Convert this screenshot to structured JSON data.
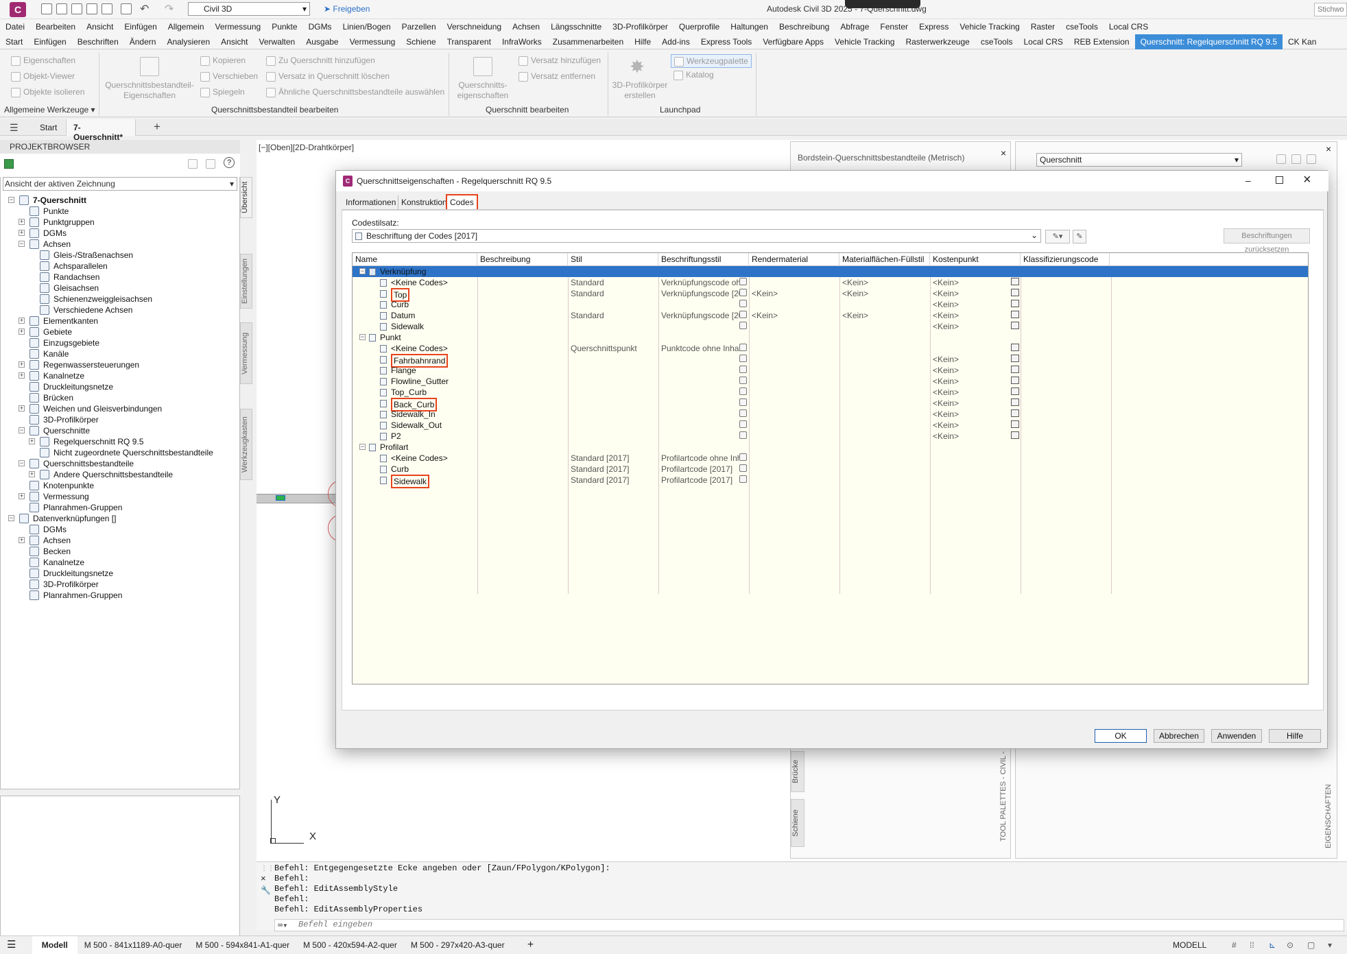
{
  "titlebar": {
    "logo": "C",
    "workspace": "Civil 3D",
    "share": "Freigeben",
    "title": "Autodesk Civil 3D 2025 - 7-Querschnitt.dwg",
    "search": "Stichwo"
  },
  "menu1": [
    "Datei",
    "Bearbeiten",
    "Ansicht",
    "Einfügen",
    "Allgemein",
    "Vermessung",
    "Punkte",
    "DGMs",
    "Linien/Bogen",
    "Parzellen",
    "Verschneidung",
    "Achsen",
    "Längsschnitte",
    "3D-Profilkörper",
    "Querprofile",
    "Haltungen",
    "Beschreibung",
    "Abfrage",
    "Fenster",
    "Express",
    "Vehicle Tracking",
    "Raster",
    "cseTools",
    "Local CRS"
  ],
  "menu2": [
    "Start",
    "Einfügen",
    "Beschriften",
    "Ändern",
    "Analysieren",
    "Ansicht",
    "Verwalten",
    "Ausgabe",
    "Vermessung",
    "Schiene",
    "Transparent",
    "InfraWorks",
    "Zusammenarbeiten",
    "Hilfe",
    "Add-ins",
    "Express Tools",
    "Verfügbare Apps",
    "Vehicle Tracking",
    "Rasterwerkzeuge",
    "cseTools",
    "Local CRS",
    "REB Extension",
    "Querschnitt: Regelquerschnitt RQ 9.5",
    "CK Kan"
  ],
  "ribbon": {
    "general": {
      "items": [
        "Eigenschaften",
        "Objekt-Viewer",
        "Objekte isolieren"
      ],
      "title": "Allgemeine Werkzeuge"
    },
    "part": {
      "big": "Querschnittsbestandteil-Eigenschaften",
      "col1": [
        "Kopieren",
        "Verschieben",
        "Spiegeln"
      ],
      "col2": [
        "Zu Querschnitt hinzufügen",
        "Versatz in Querschnitt löschen",
        "Ähnliche Querschnittsbestandteile auswählen"
      ],
      "title": "Querschnittsbestandteil bearbeiten"
    },
    "assembly": {
      "big": "Querschnitts-eigenschaften",
      "col": [
        "Versatz hinzufügen",
        "Versatz entfernen"
      ],
      "title": "Querschnitt bearbeiten"
    },
    "launch": {
      "big": "3D-Profilkörper erstellen",
      "col": [
        "Werkzeugpalette",
        "Katalog"
      ],
      "title": "Launchpad"
    }
  },
  "doctabs": {
    "start": "Start",
    "current": "7-Querschnitt*"
  },
  "browser": {
    "title": "PROJEKTBROWSER",
    "view": "Ansicht der aktiven Zeichnung",
    "tree": [
      {
        "label": "7-Querschnitt",
        "lvl": 0,
        "bold": true,
        "t": "-"
      },
      {
        "label": "Punkte",
        "lvl": 1,
        "t": ""
      },
      {
        "label": "Punktgruppen",
        "lvl": 1,
        "t": "+"
      },
      {
        "label": "DGMs",
        "lvl": 1,
        "t": "+"
      },
      {
        "label": "Achsen",
        "lvl": 1,
        "t": "-"
      },
      {
        "label": "Gleis-/Straßenachsen",
        "lvl": 2,
        "t": ""
      },
      {
        "label": "Achsparallelen",
        "lvl": 2,
        "t": ""
      },
      {
        "label": "Randachsen",
        "lvl": 2,
        "t": ""
      },
      {
        "label": "Gleisachsen",
        "lvl": 2,
        "t": ""
      },
      {
        "label": "Schienenzweiggleisachsen",
        "lvl": 2,
        "t": ""
      },
      {
        "label": "Verschiedene Achsen",
        "lvl": 2,
        "t": ""
      },
      {
        "label": "Elementkanten",
        "lvl": 1,
        "t": "+"
      },
      {
        "label": "Gebiete",
        "lvl": 1,
        "t": "+"
      },
      {
        "label": "Einzugsgebiete",
        "lvl": 1,
        "t": ""
      },
      {
        "label": "Kanäle",
        "lvl": 1,
        "t": ""
      },
      {
        "label": "Regenwassersteuerungen",
        "lvl": 1,
        "t": "+"
      },
      {
        "label": "Kanalnetze",
        "lvl": 1,
        "t": "+"
      },
      {
        "label": "Druckleitungsnetze",
        "lvl": 1,
        "t": ""
      },
      {
        "label": "Brücken",
        "lvl": 1,
        "t": ""
      },
      {
        "label": "Weichen und Gleisverbindungen",
        "lvl": 1,
        "t": "+"
      },
      {
        "label": "3D-Profilkörper",
        "lvl": 1,
        "t": ""
      },
      {
        "label": "Querschnitte",
        "lvl": 1,
        "t": "-"
      },
      {
        "label": "Regelquerschnitt RQ 9.5",
        "lvl": 2,
        "t": "+"
      },
      {
        "label": "Nicht zugeordnete Querschnittsbestandteile",
        "lvl": 2,
        "t": ""
      },
      {
        "label": "Querschnittsbestandteile",
        "lvl": 1,
        "t": "-"
      },
      {
        "label": "Andere Querschnittsbestandteile",
        "lvl": 2,
        "t": "+"
      },
      {
        "label": "Knotenpunkte",
        "lvl": 1,
        "t": ""
      },
      {
        "label": "Vermessung",
        "lvl": 1,
        "t": "+"
      },
      {
        "label": "Planrahmen-Gruppen",
        "lvl": 1,
        "t": ""
      },
      {
        "label": "Datenverknüpfungen []",
        "lvl": 0,
        "t": "-"
      },
      {
        "label": "DGMs",
        "lvl": 1,
        "t": ""
      },
      {
        "label": "Achsen",
        "lvl": 1,
        "t": "+"
      },
      {
        "label": "Becken",
        "lvl": 1,
        "t": ""
      },
      {
        "label": "Kanalnetze",
        "lvl": 1,
        "t": ""
      },
      {
        "label": "Druckleitungsnetze",
        "lvl": 1,
        "t": ""
      },
      {
        "label": "3D-Profilkörper",
        "lvl": 1,
        "t": ""
      },
      {
        "label": "Planrahmen-Gruppen",
        "lvl": 1,
        "t": ""
      }
    ],
    "sidetabs": [
      "Übersicht",
      "Einstellungen",
      "Vermessung",
      "Werkzeugkasten"
    ]
  },
  "view": {
    "label": "[−][Oben][2D-Drahtkörper]",
    "axis_y": "Y",
    "axis_x": "X"
  },
  "palette": {
    "title": "Bordstein-Querschnittsbestandteile (Metrisch)",
    "sel": "Querschnitt",
    "tabs": [
      "Brücke",
      "Schiene"
    ],
    "vlabel": "TOOL PALETTES - CIVIL -",
    "vlabel2": "EIGENSCHAFTEN"
  },
  "dialog": {
    "title": "Querschnittseigenschaften - Regelquerschnitt RQ 9.5",
    "tabs": [
      "Informationen",
      "Konstruktion",
      "Codes"
    ],
    "codeset_label": "Codestilsatz:",
    "codeset": "Beschriftung der Codes [2017]",
    "reset": "Beschriftungen zurücksetzen",
    "columns": [
      "Name",
      "Beschreibung",
      "Stil",
      "Beschriftungsstil",
      "Rendermaterial",
      "Materialflächen-Füllstil",
      "Kostenpunkt",
      "Klassifizierungscode"
    ],
    "rows": [
      {
        "name": "Verknüpfung",
        "lvl": 0,
        "sel": true,
        "t": "-"
      },
      {
        "name": "<Keine Codes>",
        "lvl": 1,
        "stil": "Standard",
        "bstil": "Verknüpfungscode ohne ...",
        "render": "",
        "mat": "<Kein>",
        "kost": "<Kein>",
        "edit": true,
        "cost": true
      },
      {
        "name": "Top",
        "lvl": 1,
        "hl": true,
        "stil": "Standard",
        "bstil": "Verknüpfungscode [2017]",
        "render": "<Kein>",
        "mat": "<Kein>",
        "kost": "<Kein>",
        "edit": true,
        "cost": true
      },
      {
        "name": "Curb",
        "lvl": 1,
        "kost": "<Kein>",
        "edit": true,
        "cost": true
      },
      {
        "name": "Datum",
        "lvl": 1,
        "stil": "Standard",
        "bstil": "Verknüpfungscode [2017]",
        "render": "<Kein>",
        "mat": "<Kein>",
        "kost": "<Kein>",
        "edit": true,
        "cost": true
      },
      {
        "name": "Sidewalk",
        "lvl": 1,
        "kost": "<Kein>",
        "edit": true,
        "cost": true
      },
      {
        "name": "Punkt",
        "lvl": 0,
        "t": "-"
      },
      {
        "name": "<Keine Codes>",
        "lvl": 1,
        "stil": "Querschnittspunkt",
        "bstil": "Punktcode ohne Inhalt [2...",
        "kost": "",
        "edit": true,
        "cost": true
      },
      {
        "name": "Fahrbahnrand",
        "lvl": 1,
        "hl": true,
        "kost": "<Kein>",
        "edit": true,
        "cost": true
      },
      {
        "name": "Flange",
        "lvl": 1,
        "kost": "<Kein>",
        "edit": true,
        "cost": true
      },
      {
        "name": "Flowline_Gutter",
        "lvl": 1,
        "kost": "<Kein>",
        "edit": true,
        "cost": true
      },
      {
        "name": "Top_Curb",
        "lvl": 1,
        "kost": "<Kein>",
        "edit": true,
        "cost": true
      },
      {
        "name": "Back_Curb",
        "lvl": 1,
        "hl": true,
        "kost": "<Kein>",
        "edit": true,
        "cost": true
      },
      {
        "name": "Sidewalk_In",
        "lvl": 1,
        "kost": "<Kein>",
        "edit": true,
        "cost": true
      },
      {
        "name": "Sidewalk_Out",
        "lvl": 1,
        "kost": "<Kein>",
        "edit": true,
        "cost": true
      },
      {
        "name": "P2",
        "lvl": 1,
        "kost": "<Kein>",
        "edit": true,
        "cost": true
      },
      {
        "name": "Profilart",
        "lvl": 0,
        "t": "-"
      },
      {
        "name": "<Keine Codes>",
        "lvl": 1,
        "stil": "Standard [2017]",
        "bstil": "Profilartcode ohne Inhalt...",
        "edit": true
      },
      {
        "name": "Curb",
        "lvl": 1,
        "stil": "Standard [2017]",
        "bstil": "Profilartcode [2017]",
        "edit": true
      },
      {
        "name": "Sidewalk",
        "lvl": 1,
        "hl": true,
        "stil": "Standard [2017]",
        "bstil": "Profilartcode [2017]",
        "edit": true
      }
    ],
    "buttons": {
      "ok": "OK",
      "cancel": "Abbrechen",
      "apply": "Anwenden",
      "help": "Hilfe"
    }
  },
  "cmd": {
    "lines": [
      "Befehl: Entgegengesetzte Ecke angeben oder [Zaun/FPolygon/KPolygon]:",
      "Befehl:",
      "Befehl: EditAssemblyStyle",
      "Befehl:",
      "Befehl: EditAssemblyProperties"
    ],
    "placeholder": "Befehl eingeben"
  },
  "status": {
    "tabs": [
      "Modell",
      "M 500 - 841x1189-A0-quer",
      "M 500 - 594x841-A1-quer",
      "M 500 - 420x594-A2-quer",
      "M 500 - 297x420-A3-quer"
    ],
    "mode": "MODELL"
  },
  "colors": {
    "accent": "#3c8dd8",
    "highlight": "#e8421c",
    "selection": "#2d73c8",
    "grid_bg": "#fffff1"
  }
}
